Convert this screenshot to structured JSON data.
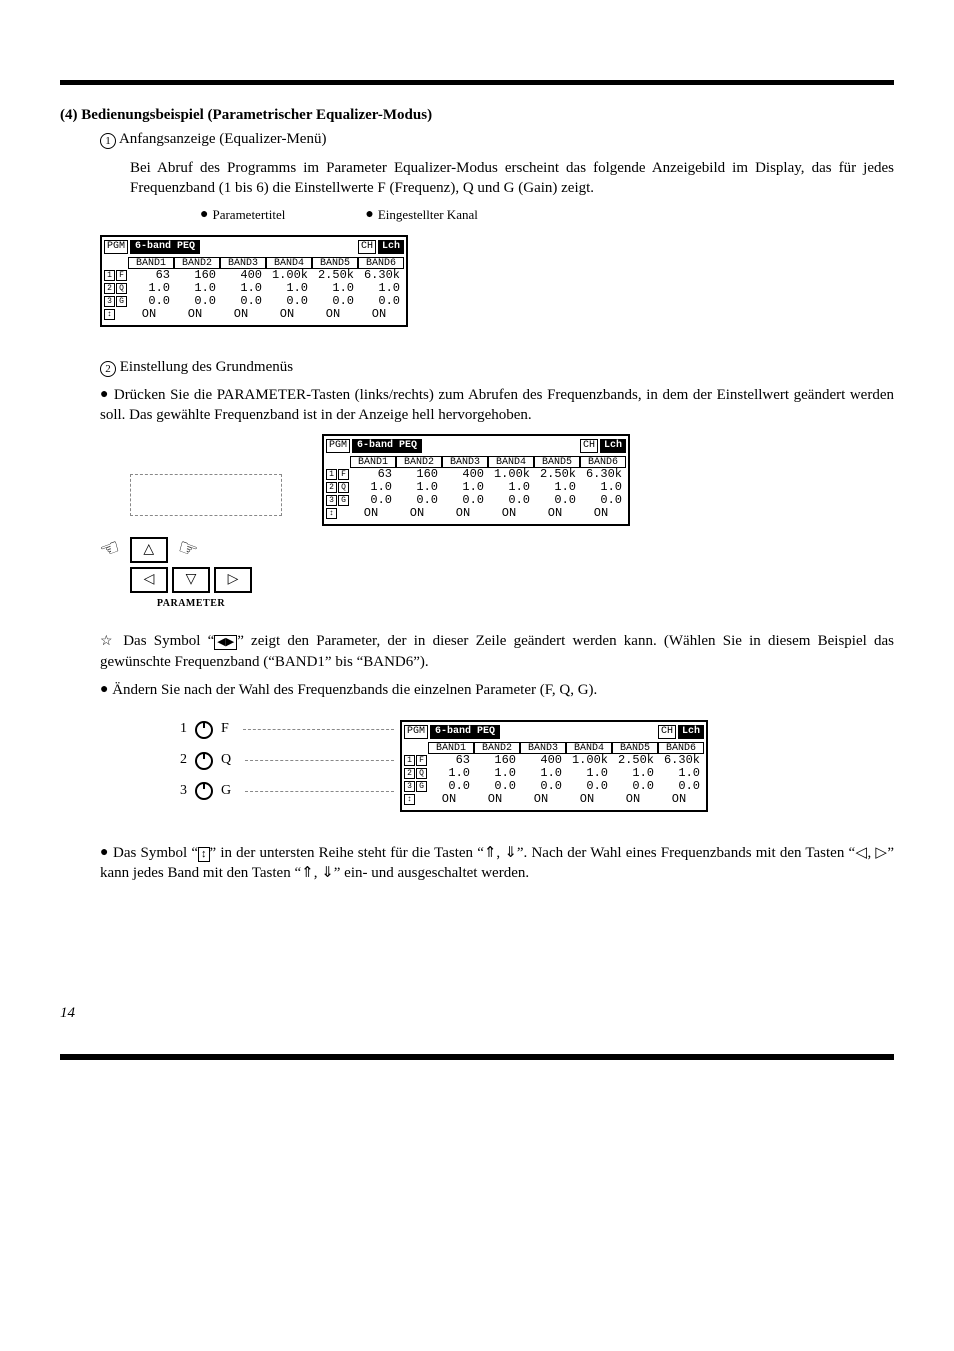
{
  "section": {
    "number": "(4)",
    "title": "Bedienungsbeispiel (Parametrischer Equalizer-Modus)"
  },
  "step1": {
    "marker": "①",
    "heading": "Anfangsanzeige (Equalizer-Menü)",
    "text": "Bei Abruf des Programms im Parameter Equalizer-Modus erscheint das folgende Anzeigebild im Display, das für jedes Frequenzband (1 bis 6) die Einstellwerte F (Frequenz), Q und G (Gain) zeigt."
  },
  "lcd_labels": {
    "title": "Parametertitel",
    "channel": "Eingestellter Kanal"
  },
  "display": {
    "pgm_chip": "PGM",
    "title_black": "6-band PEQ",
    "ch_chip": "CH",
    "lch": "Lch",
    "band_headers": [
      "BAND1",
      "BAND2",
      "BAND3",
      "BAND4",
      "BAND5",
      "BAND6"
    ],
    "side_labels_col1": [
      "①",
      "②",
      "③"
    ],
    "side_labels_col2": [
      "F",
      "Q",
      "G"
    ],
    "side_last": "↕",
    "rows": {
      "F": [
        "63",
        "160",
        "400",
        "1.00k",
        "2.50k",
        "6.30k"
      ],
      "Q": [
        "1.0",
        "1.0",
        "1.0",
        "1.0",
        "1.0",
        "1.0"
      ],
      "G": [
        "0.0",
        "0.0",
        "0.0",
        "0.0",
        "0.0",
        "0.0"
      ],
      "ON": [
        "ON",
        "ON",
        "ON",
        "ON",
        "ON",
        "ON"
      ]
    }
  },
  "step2": {
    "marker": "②",
    "heading": "Einstellung des Grundmenüs",
    "bullet_text": "Drücken Sie die PARAMETER-Tasten (links/rechts) zum Abrufen des Frequenzbands, in dem der Einstellwert geändert werden soll. Das gewählte Frequenzband ist in der Anzeige hell hervorgehoben."
  },
  "keys_label": "PARAMETER",
  "note_star_a": "Das Symbol “",
  "note_star_sym": "◀▶",
  "note_star_b": "” zeigt den Parameter, der in dieser Zeile geändert werden kann. (Wählen Sie in diesem Beispiel das gewünschte Frequenzband (“BAND1” bis “BAND6”).",
  "bullet3": "Ändern Sie nach der Wahl des Frequenzbands die einzelnen Parameter (F, Q, G).",
  "fqg": {
    "items": [
      {
        "n": "1",
        "label": "F"
      },
      {
        "n": "2",
        "label": "Q"
      },
      {
        "n": "3",
        "label": "G"
      }
    ]
  },
  "bullet4_a": "Das Symbol “",
  "bullet4_sym": "↕",
  "bullet4_b": "” in der untersten Reihe steht für die Tasten “⇑, ⇓”. Nach der Wahl eines Frequenzbands mit den Tasten “◁, ▷” kann jedes Band mit den Tasten “⇑, ⇓” ein- und ausgeschaltet werden.",
  "page_number": "14"
}
